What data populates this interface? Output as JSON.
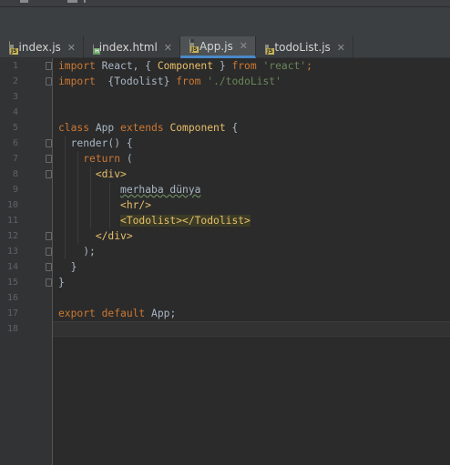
{
  "tabs": [
    {
      "label": "index.js",
      "icon": "js-file-icon",
      "badge": "JS",
      "active": false
    },
    {
      "label": "index.html",
      "icon": "html-file-icon",
      "badge": "H",
      "active": false
    },
    {
      "label": "App.js",
      "icon": "js-file-icon",
      "badge": "JS",
      "active": true
    },
    {
      "label": "todoList.js",
      "icon": "js-file-icon",
      "badge": "JS",
      "active": false
    }
  ],
  "editor": {
    "current_line": 18,
    "lines": [
      {
        "n": "1",
        "tokens": [
          [
            "kw",
            "import"
          ],
          [
            "plain",
            " React, { "
          ],
          [
            "tag",
            "Component"
          ],
          [
            "plain",
            " } "
          ],
          [
            "kw",
            "from"
          ],
          [
            "plain",
            " "
          ],
          [
            "str",
            "'react'"
          ],
          [
            "kw",
            ";"
          ]
        ]
      },
      {
        "n": "2",
        "tokens": [
          [
            "kw",
            "import"
          ],
          [
            "plain",
            "  {Todolist} "
          ],
          [
            "kw",
            "from"
          ],
          [
            "plain",
            " "
          ],
          [
            "str",
            "'./todoList'"
          ]
        ]
      },
      {
        "n": "3",
        "tokens": []
      },
      {
        "n": "4",
        "tokens": []
      },
      {
        "n": "5",
        "tokens": [
          [
            "kw",
            "class"
          ],
          [
            "plain",
            " App "
          ],
          [
            "kw",
            "extends"
          ],
          [
            "plain",
            " "
          ],
          [
            "tag",
            "Component"
          ],
          [
            "plain",
            " {"
          ]
        ]
      },
      {
        "n": "6",
        "tokens": [
          [
            "plain",
            "  render() {"
          ]
        ]
      },
      {
        "n": "7",
        "tokens": [
          [
            "plain",
            "    "
          ],
          [
            "kw",
            "return"
          ],
          [
            "plain",
            " ("
          ]
        ]
      },
      {
        "n": "8",
        "tokens": [
          [
            "plain",
            "      "
          ],
          [
            "tag",
            "<div>"
          ]
        ]
      },
      {
        "n": "9",
        "tokens": [
          [
            "plain",
            "          "
          ],
          [
            "typo",
            "merhaba dünya"
          ]
        ]
      },
      {
        "n": "10",
        "tokens": [
          [
            "plain",
            "          "
          ],
          [
            "tag",
            "<hr/>"
          ]
        ]
      },
      {
        "n": "11",
        "tokens": [
          [
            "plain",
            "          "
          ],
          [
            "hltag",
            "<Todolist></Todolist>"
          ]
        ]
      },
      {
        "n": "12",
        "tokens": [
          [
            "plain",
            "      "
          ],
          [
            "tag",
            "</div>"
          ]
        ]
      },
      {
        "n": "13",
        "tokens": [
          [
            "plain",
            "    );"
          ]
        ]
      },
      {
        "n": "14",
        "tokens": [
          [
            "plain",
            "  }"
          ]
        ]
      },
      {
        "n": "15",
        "tokens": [
          [
            "plain",
            "}"
          ]
        ]
      },
      {
        "n": "16",
        "tokens": []
      },
      {
        "n": "17",
        "tokens": [
          [
            "kw",
            "export"
          ],
          [
            "plain",
            " "
          ],
          [
            "kw",
            "default"
          ],
          [
            "plain",
            " App;"
          ]
        ]
      },
      {
        "n": "18",
        "tokens": []
      }
    ]
  },
  "colors": {
    "keyword": "#cc7832",
    "string": "#6a8759",
    "tag": "#e8bf6a",
    "text": "#a9b7c6",
    "background": "#2b2b2b",
    "active_tab_underline": "#4a88c7"
  }
}
